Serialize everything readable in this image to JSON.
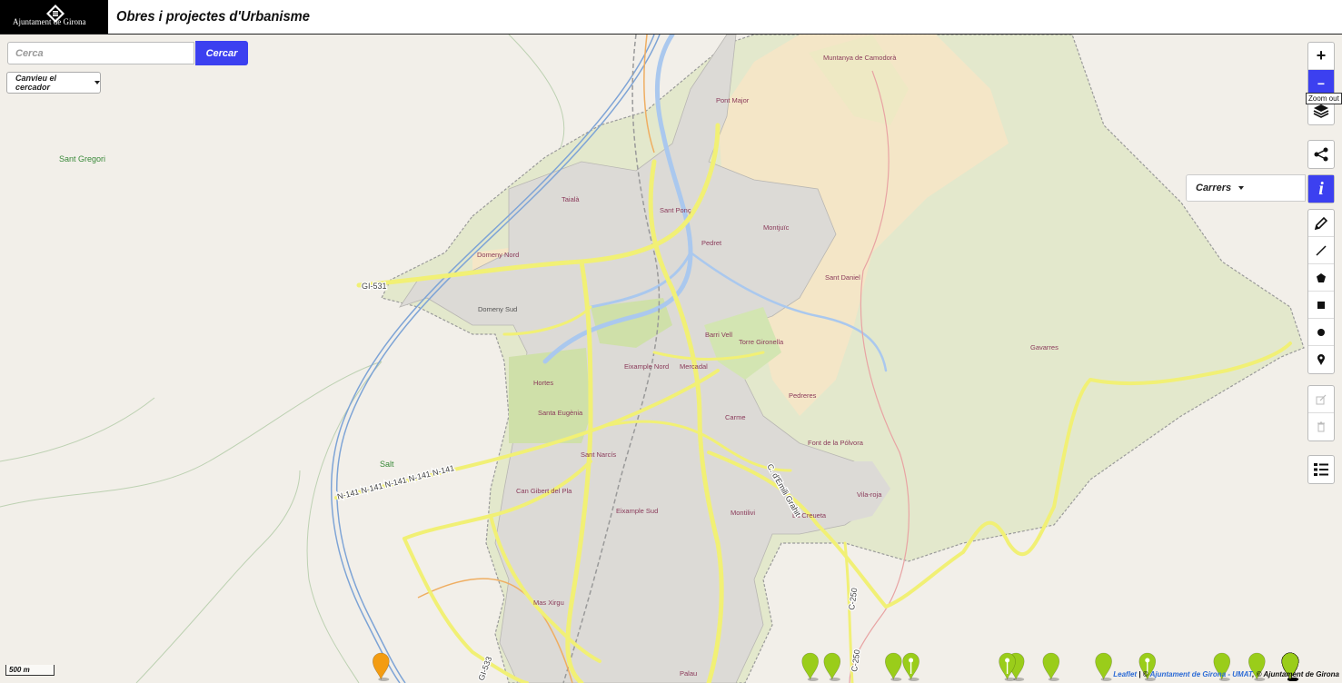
{
  "header": {
    "logo_text": "Ajuntament de Girona",
    "title": "Obres i projectes d'Urbanisme"
  },
  "search": {
    "placeholder": "Cerca",
    "value": "",
    "button": "Cercar"
  },
  "switcher": {
    "label": "Canvieu el cercador"
  },
  "layer_select": {
    "label": "Carrers"
  },
  "controls": {
    "zoom_in": "+",
    "zoom_out": "−",
    "tooltip": "Zoom out",
    "info": "i",
    "icons": [
      "layers-icon",
      "share-icon",
      "info-icon",
      "pencil-icon",
      "polyline-icon",
      "polygon-icon",
      "rectangle-icon",
      "circle-icon",
      "marker-icon",
      "edit-icon",
      "trash-icon",
      "legend-icon"
    ]
  },
  "scale": {
    "label": "500 m"
  },
  "attribution": {
    "leaflet": "Leaflet",
    "sep1": " | © ",
    "umat": "Ajuntament de Girona - UMAT",
    "sep2": ", © Ajuntament de Girona"
  },
  "map": {
    "colors": {
      "land": "#f2efe9",
      "urban": "#dedcd8",
      "park": "#e3e8cc",
      "sand": "#f5e6c6",
      "water": "#aac8ee",
      "road_yellow": "#f1f075",
      "boundary": "#999999",
      "marker_green": "#9acd1a",
      "marker_orange": "#f39c12",
      "marker_magenta": "#ea1f8e"
    },
    "place_labels": [
      {
        "text": "Muntanya de Camodorà"
      },
      {
        "text": "Pont Major"
      },
      {
        "text": "Sant Gregori"
      },
      {
        "text": "Taialà"
      },
      {
        "text": "Sant Ponç"
      },
      {
        "text": "Domeny Nord"
      },
      {
        "text": "Pedret"
      },
      {
        "text": "Montjuïc"
      },
      {
        "text": "Sant Daniel"
      },
      {
        "text": "Domeny Sud"
      },
      {
        "text": "Barri Vell"
      },
      {
        "text": "Torre Gironella"
      },
      {
        "text": "Gavarres"
      },
      {
        "text": "Eixample Nord"
      },
      {
        "text": "Mercadal"
      },
      {
        "text": "Hortes"
      },
      {
        "text": "Pedreres"
      },
      {
        "text": "Santa Eugènia"
      },
      {
        "text": "Carme"
      },
      {
        "text": "Font de la Pólvora"
      },
      {
        "text": "Salt"
      },
      {
        "text": "Sant Narcís"
      },
      {
        "text": "Can Gibert del Pla"
      },
      {
        "text": "Vila-roja"
      },
      {
        "text": "Eixample Sud"
      },
      {
        "text": "Montilivi"
      },
      {
        "text": "La Creueta"
      },
      {
        "text": "Mas Xirgu"
      },
      {
        "text": "Palau"
      }
    ],
    "road_labels": [
      {
        "text": "GI-531"
      },
      {
        "text": "Domeny Sud"
      },
      {
        "text": "N-141  N-141  N-141  N-141  N-141"
      },
      {
        "text": "C-250"
      },
      {
        "text": "C-250"
      },
      {
        "text": "C. d'Emili Grahit"
      },
      {
        "text": "GI-533"
      }
    ],
    "markers": [
      {
        "lat": 41.9966,
        "lng": 2.8262,
        "status": "orange",
        "pin": false
      },
      {
        "lat": 41.9916,
        "lng": 2.8186,
        "status": "orange",
        "pin": false
      },
      {
        "lat": 41.9925,
        "lng": 2.8191,
        "status": "green",
        "pin": false
      },
      {
        "lat": 41.9899,
        "lng": 2.7985,
        "status": "green",
        "pin": false
      },
      {
        "lat": 41.9899,
        "lng": 2.8008,
        "status": "green",
        "pin": true
      },
      {
        "lat": 41.9895,
        "lng": 2.8032,
        "status": "green",
        "pin": false
      },
      {
        "lat": 41.988,
        "lng": 2.8052,
        "status": "green",
        "pin": false
      },
      {
        "lat": 41.987,
        "lng": 2.799,
        "status": "green",
        "pin": false
      },
      {
        "lat": 41.9849,
        "lng": 2.8004,
        "status": "green",
        "pin": false
      },
      {
        "lat": 41.9845,
        "lng": 2.7887,
        "status": "orange",
        "pin": false
      },
      {
        "lat": 41.9866,
        "lng": 2.815,
        "status": "green",
        "pin": false
      },
      {
        "lat": 41.9858,
        "lng": 2.8133,
        "status": "green",
        "pin": false
      },
      {
        "lat": 41.9849,
        "lng": 2.8128,
        "status": "green",
        "pin": false
      },
      {
        "lat": 41.9881,
        "lng": 2.8169,
        "status": "green",
        "pin": true
      },
      {
        "lat": 41.9871,
        "lng": 2.8181,
        "status": "green",
        "pin": false
      },
      {
        "lat": 41.9836,
        "lng": 2.8202,
        "status": "green",
        "pin": false
      },
      {
        "lat": 41.9883,
        "lng": 2.8238,
        "status": "green",
        "pin": true
      },
      {
        "lat": 41.9888,
        "lng": 2.8253,
        "status": "orange",
        "pin": false
      },
      {
        "lat": 41.9907,
        "lng": 2.827,
        "status": "green",
        "pin": false
      },
      {
        "lat": 41.99,
        "lng": 2.8272,
        "status": "green",
        "pin": false
      },
      {
        "lat": 41.9875,
        "lng": 2.8282,
        "status": "green",
        "pin": true
      },
      {
        "lat": 41.9856,
        "lng": 2.8266,
        "status": "green",
        "pin": false
      },
      {
        "lat": 41.9855,
        "lng": 2.8295,
        "status": "green",
        "pin": false
      },
      {
        "lat": 41.9828,
        "lng": 2.8276,
        "status": "green",
        "pin": false
      },
      {
        "lat": 41.9851,
        "lng": 2.8334,
        "status": "magenta",
        "pin": true
      },
      {
        "lat": 41.9843,
        "lng": 2.8347,
        "status": "green",
        "pin": true
      },
      {
        "lat": 41.9843,
        "lng": 2.8408,
        "status": "magenta",
        "pin": true
      },
      {
        "lat": 41.9828,
        "lng": 2.8425,
        "status": "green",
        "pin": false
      },
      {
        "lat": 41.9915,
        "lng": 2.8414,
        "status": "green",
        "pin": false
      },
      {
        "lat": 41.9819,
        "lng": 2.823,
        "status": "green",
        "pin": false
      },
      {
        "lat": 41.9812,
        "lng": 2.8209,
        "status": "green",
        "pin": false
      },
      {
        "lat": 41.9806,
        "lng": 2.8221,
        "status": "green",
        "pin": true
      },
      {
        "lat": 41.9806,
        "lng": 2.8237,
        "status": "green",
        "pin": false
      },
      {
        "lat": 41.9796,
        "lng": 2.824,
        "status": "green",
        "pin": false
      },
      {
        "lat": 41.9798,
        "lng": 2.826,
        "status": "magenta",
        "pin": false
      },
      {
        "lat": 41.979,
        "lng": 2.827,
        "status": "orange",
        "pin": false
      },
      {
        "lat": 41.9786,
        "lng": 2.823,
        "status": "green",
        "pin": false
      },
      {
        "lat": 41.9788,
        "lng": 2.8246,
        "status": "green",
        "pin": true
      },
      {
        "lat": 41.9782,
        "lng": 2.827,
        "status": "green",
        "pin": false
      },
      {
        "lat": 41.9775,
        "lng": 2.827,
        "status": "green",
        "pin": false
      },
      {
        "lat": 41.9778,
        "lng": 2.8205,
        "status": "green",
        "pin": false
      },
      {
        "lat": 41.9768,
        "lng": 2.8278,
        "status": "green",
        "pin": true
      },
      {
        "lat": 41.9764,
        "lng": 2.8235,
        "status": "orange",
        "pin": false
      },
      {
        "lat": 41.9751,
        "lng": 2.8253,
        "status": "green",
        "pin": false
      },
      {
        "lat": 41.9746,
        "lng": 2.8289,
        "status": "magenta",
        "pin": false
      },
      {
        "lat": 41.9743,
        "lng": 2.8293,
        "status": "green",
        "pin": false
      },
      {
        "lat": 41.9737,
        "lng": 2.8287,
        "status": "green",
        "pin": true
      },
      {
        "lat": 41.9747,
        "lng": 2.8196,
        "status": "orange",
        "pin": false
      },
      {
        "lat": 41.9738,
        "lng": 2.8166,
        "status": "orange",
        "pin": true
      },
      {
        "lat": 41.9738,
        "lng": 2.8157,
        "status": "green",
        "pin": false
      },
      {
        "lat": 41.9727,
        "lng": 2.8158,
        "status": "magenta",
        "pin": false
      },
      {
        "lat": 41.9726,
        "lng": 2.8219,
        "status": "green",
        "pin": false
      },
      {
        "lat": 41.9721,
        "lng": 2.82,
        "status": "green",
        "pin": false
      },
      {
        "lat": 41.971,
        "lng": 2.821,
        "status": "green",
        "pin": false
      },
      {
        "lat": 41.972,
        "lng": 2.8087,
        "status": "green",
        "pin": false
      },
      {
        "lat": 41.9718,
        "lng": 2.8097,
        "status": "green",
        "pin": true
      },
      {
        "lat": 41.9705,
        "lng": 2.8187,
        "status": "green",
        "pin": false
      },
      {
        "lat": 41.9701,
        "lng": 2.8225,
        "status": "green",
        "pin": true
      },
      {
        "lat": 41.9701,
        "lng": 2.8234,
        "status": "green",
        "pin": false
      },
      {
        "lat": 41.9705,
        "lng": 2.8259,
        "status": "green",
        "pin": false
      },
      {
        "lat": 41.9695,
        "lng": 2.8277,
        "status": "green",
        "pin": false
      },
      {
        "lat": 41.969,
        "lng": 2.8285,
        "status": "magenta",
        "pin": false
      },
      {
        "lat": 41.9686,
        "lng": 2.8163,
        "status": "green",
        "pin": false
      },
      {
        "lat": 41.9688,
        "lng": 2.8173,
        "status": "green",
        "pin": true
      },
      {
        "lat": 41.969,
        "lng": 2.8185,
        "status": "green",
        "pin": false
      },
      {
        "lat": 41.9685,
        "lng": 2.8204,
        "status": "orange",
        "pin": false
      },
      {
        "lat": 41.9685,
        "lng": 2.823,
        "status": "green",
        "pin": false
      },
      {
        "lat": 41.9678,
        "lng": 2.8265,
        "status": "green",
        "pin": true
      },
      {
        "lat": 41.9681,
        "lng": 2.8127,
        "status": "green",
        "pin": false
      },
      {
        "lat": 41.9709,
        "lng": 2.8377,
        "status": "magenta",
        "pin": false
      },
      {
        "lat": 41.9702,
        "lng": 2.8373,
        "status": "green",
        "pin": false
      },
      {
        "lat": 41.9696,
        "lng": 2.8403,
        "status": "green",
        "pin": true
      },
      {
        "lat": 41.969,
        "lng": 2.8378,
        "status": "green",
        "pin": true
      },
      {
        "lat": 41.9675,
        "lng": 2.8369,
        "status": "green",
        "pin": false
      },
      {
        "lat": 41.9673,
        "lng": 2.8374,
        "status": "green",
        "pin": false
      },
      {
        "lat": 41.966,
        "lng": 2.8298,
        "status": "orange",
        "pin": false
      },
      {
        "lat": 41.9658,
        "lng": 2.8176,
        "status": "orange",
        "pin": false
      },
      {
        "lat": 41.963,
        "lng": 2.8265,
        "status": "green",
        "pin": false
      },
      {
        "lat": 41.9618,
        "lng": 2.8151,
        "status": "green",
        "pin": false
      },
      {
        "lat": 41.9612,
        "lng": 2.8182,
        "status": "green",
        "pin": false
      },
      {
        "lat": 41.9608,
        "lng": 2.8205,
        "status": "green",
        "pin": false
      },
      {
        "lat": 41.9605,
        "lng": 2.822,
        "status": "magenta",
        "pin": false
      },
      {
        "lat": 41.9595,
        "lng": 2.8218,
        "status": "orange",
        "pin": false
      },
      {
        "lat": 41.9582,
        "lng": 2.8148,
        "status": "orange",
        "pin": false
      },
      {
        "lat": 41.9757,
        "lng": 2.8079,
        "status": "green",
        "pin": false
      },
      {
        "lat": 41.9756,
        "lng": 2.8062,
        "status": "green",
        "pin": true
      },
      {
        "lat": 41.9748,
        "lng": 2.8095,
        "status": "magenta",
        "pin": false
      },
      {
        "lat": 41.9744,
        "lng": 2.8118,
        "status": "green",
        "pin": false
      },
      {
        "lat": 41.9742,
        "lng": 2.8125,
        "status": "green",
        "pin": true
      },
      {
        "lat": 41.9768,
        "lng": 2.804,
        "status": "green",
        "pin": false
      },
      {
        "lat": 41.977,
        "lng": 2.803,
        "status": "green",
        "pin": true
      },
      {
        "lat": 41.9779,
        "lng": 2.8113,
        "status": "green",
        "pin": false
      }
    ]
  }
}
